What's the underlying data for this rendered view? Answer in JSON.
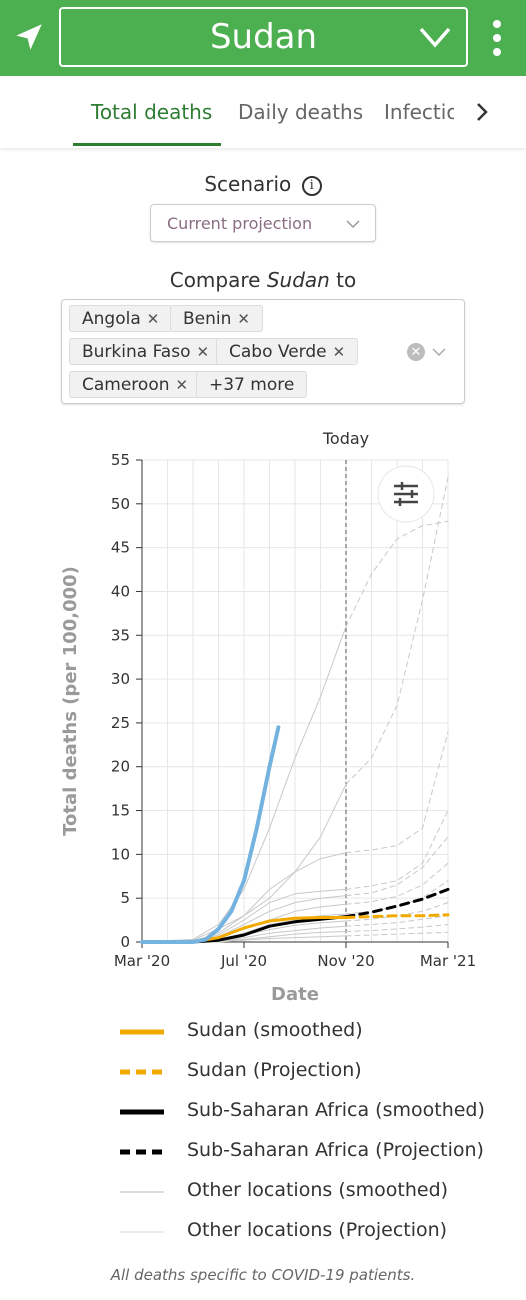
{
  "header": {
    "location": "Sudan",
    "colors": {
      "bar": "#4caf50",
      "text": "#ffffff"
    },
    "icons": {
      "nav": "navigation-arrow-icon",
      "dropdown": "chevron-down-icon",
      "menu": "more-vertical-icon"
    }
  },
  "tabs": [
    {
      "label": "Total deaths",
      "active": true
    },
    {
      "label": "Daily deaths",
      "active": false
    },
    {
      "label": "Infectio",
      "active": false
    }
  ],
  "scenario": {
    "label": "Scenario",
    "value": "Current projection"
  },
  "compare": {
    "label_prefix": "Compare ",
    "location": "Sudan",
    "label_suffix": " to",
    "chips": [
      "Angola",
      "Benin",
      "Burkina Faso",
      "Cabo Verde",
      "Cameroon"
    ],
    "more": "+37 more"
  },
  "chart_data": {
    "type": "line",
    "today_label": "Today",
    "xlabel": "Date",
    "ylabel": "Total deaths (per 100,000)",
    "ylim": [
      0,
      55
    ],
    "yticks": [
      0,
      5,
      10,
      15,
      20,
      25,
      30,
      35,
      40,
      45,
      50,
      55
    ],
    "xticks": [
      {
        "label": "Mar '20",
        "month": 0
      },
      {
        "label": "Jul '20",
        "month": 4
      },
      {
        "label": "Nov '20",
        "month": 8
      },
      {
        "label": "Mar '21",
        "month": 12
      }
    ],
    "today_month": 8.0,
    "series": [
      {
        "name": "Sudan (smoothed)",
        "color": "#f2a900",
        "style": "solid",
        "width": 3,
        "points": [
          [
            0,
            0
          ],
          [
            2,
            0
          ],
          [
            3,
            0.5
          ],
          [
            4,
            1.6
          ],
          [
            5,
            2.4
          ],
          [
            6,
            2.7
          ],
          [
            7,
            2.8
          ],
          [
            8,
            2.8
          ]
        ]
      },
      {
        "name": "Sudan (Projection)",
        "color": "#f2a900",
        "style": "dashed",
        "width": 3,
        "points": [
          [
            8,
            2.8
          ],
          [
            9,
            2.9
          ],
          [
            10,
            3.0
          ],
          [
            11,
            3.0
          ],
          [
            12,
            3.1
          ]
        ]
      },
      {
        "name": "Sub-Saharan Africa (smoothed)",
        "color": "#000000",
        "style": "solid",
        "width": 3,
        "points": [
          [
            0,
            0
          ],
          [
            2,
            0
          ],
          [
            3,
            0.2
          ],
          [
            4,
            0.8
          ],
          [
            5,
            1.8
          ],
          [
            6,
            2.3
          ],
          [
            7,
            2.6
          ],
          [
            8,
            2.9
          ]
        ]
      },
      {
        "name": "Sub-Saharan Africa (Projection)",
        "color": "#000000",
        "style": "dashed",
        "width": 3,
        "points": [
          [
            8,
            2.9
          ],
          [
            9,
            3.4
          ],
          [
            10,
            4.1
          ],
          [
            11,
            4.9
          ],
          [
            12,
            6.0
          ]
        ]
      },
      {
        "name": "Other locations (smoothed)",
        "color": "#c8c8c8",
        "style": "solid",
        "width": 1,
        "lines": [
          [
            [
              0,
              0
            ],
            [
              2,
              0.3
            ],
            [
              3,
              2
            ],
            [
              4,
              6
            ],
            [
              5,
              13
            ],
            [
              6,
              21
            ],
            [
              7,
              28
            ],
            [
              8,
              36
            ]
          ],
          [
            [
              0,
              0
            ],
            [
              2,
              0.2
            ],
            [
              3,
              1.5
            ],
            [
              4,
              3
            ],
            [
              5,
              5
            ],
            [
              6,
              8
            ],
            [
              7,
              12
            ],
            [
              8,
              18
            ]
          ],
          [
            [
              0,
              0
            ],
            [
              2,
              0.1
            ],
            [
              3,
              1
            ],
            [
              4,
              3
            ],
            [
              5,
              6
            ],
            [
              6,
              8
            ],
            [
              7,
              9.5
            ],
            [
              8,
              10.2
            ]
          ],
          [
            [
              0,
              0
            ],
            [
              2,
              0.1
            ],
            [
              3,
              0.8
            ],
            [
              4,
              2.5
            ],
            [
              5,
              4.5
            ],
            [
              6,
              5.5
            ],
            [
              7,
              5.8
            ],
            [
              8,
              6
            ]
          ],
          [
            [
              0,
              0
            ],
            [
              2,
              0.1
            ],
            [
              3,
              0.6
            ],
            [
              4,
              2
            ],
            [
              5,
              3.5
            ],
            [
              6,
              4.5
            ],
            [
              7,
              5
            ],
            [
              8,
              5.3
            ]
          ],
          [
            [
              0,
              0
            ],
            [
              2,
              0
            ],
            [
              3,
              0.5
            ],
            [
              4,
              1.5
            ],
            [
              5,
              2.5
            ],
            [
              6,
              3.5
            ],
            [
              7,
              4
            ],
            [
              8,
              4.3
            ]
          ],
          [
            [
              0,
              0
            ],
            [
              2,
              0
            ],
            [
              3,
              0.3
            ],
            [
              4,
              1
            ],
            [
              5,
              2
            ],
            [
              6,
              2.5
            ],
            [
              7,
              3
            ],
            [
              8,
              3.2
            ]
          ],
          [
            [
              0,
              0
            ],
            [
              2,
              0
            ],
            [
              3,
              0.2
            ],
            [
              4,
              0.8
            ],
            [
              5,
              1.4
            ],
            [
              6,
              1.9
            ],
            [
              7,
              2.2
            ],
            [
              8,
              2.4
            ]
          ],
          [
            [
              0,
              0
            ],
            [
              2,
              0
            ],
            [
              3,
              0.1
            ],
            [
              4,
              0.5
            ],
            [
              5,
              1
            ],
            [
              6,
              1.3
            ],
            [
              7,
              1.6
            ],
            [
              8,
              1.8
            ]
          ],
          [
            [
              0,
              0
            ],
            [
              2,
              0
            ],
            [
              3,
              0.1
            ],
            [
              4,
              0.3
            ],
            [
              5,
              0.6
            ],
            [
              6,
              0.9
            ],
            [
              7,
              1.1
            ],
            [
              8,
              1.2
            ]
          ],
          [
            [
              0,
              0
            ],
            [
              2,
              0
            ],
            [
              3,
              0
            ],
            [
              4,
              0.2
            ],
            [
              5,
              0.4
            ],
            [
              6,
              0.5
            ],
            [
              7,
              0.6
            ],
            [
              8,
              0.7
            ]
          ]
        ]
      },
      {
        "name": "Other locations (Projection)",
        "color": "#c8c8c8",
        "style": "dashed",
        "width": 1,
        "lines": [
          [
            [
              8,
              36
            ],
            [
              9,
              42
            ],
            [
              10,
              46
            ],
            [
              11,
              47.5
            ],
            [
              12,
              48
            ]
          ],
          [
            [
              8,
              18
            ],
            [
              9,
              21
            ],
            [
              10,
              27
            ],
            [
              11,
              39
            ],
            [
              12,
              53
            ]
          ],
          [
            [
              8,
              10.2
            ],
            [
              9,
              10.5
            ],
            [
              10,
              11
            ],
            [
              11,
              13
            ],
            [
              12,
              24
            ]
          ],
          [
            [
              8,
              6
            ],
            [
              9,
              6.4
            ],
            [
              10,
              7
            ],
            [
              11,
              9
            ],
            [
              12,
              15
            ]
          ],
          [
            [
              8,
              5.3
            ],
            [
              9,
              5.6
            ],
            [
              10,
              6.5
            ],
            [
              11,
              8.5
            ],
            [
              12,
              12
            ]
          ],
          [
            [
              8,
              4.3
            ],
            [
              9,
              4.6
            ],
            [
              10,
              5.2
            ],
            [
              11,
              6.5
            ],
            [
              12,
              9
            ]
          ],
          [
            [
              8,
              3.2
            ],
            [
              9,
              3.5
            ],
            [
              10,
              4
            ],
            [
              11,
              5
            ],
            [
              12,
              7
            ]
          ],
          [
            [
              8,
              2.4
            ],
            [
              9,
              2.6
            ],
            [
              10,
              3
            ],
            [
              11,
              3.5
            ],
            [
              12,
              4.5
            ]
          ],
          [
            [
              8,
              1.8
            ],
            [
              9,
              2
            ],
            [
              10,
              2.2
            ],
            [
              11,
              2.6
            ],
            [
              12,
              3
            ]
          ],
          [
            [
              8,
              1.2
            ],
            [
              9,
              1.3
            ],
            [
              10,
              1.5
            ],
            [
              11,
              1.7
            ],
            [
              12,
              2
            ]
          ],
          [
            [
              8,
              0.7
            ],
            [
              9,
              0.8
            ],
            [
              10,
              0.9
            ],
            [
              11,
              1
            ],
            [
              12,
              1.1
            ]
          ]
        ]
      },
      {
        "name": "Highlighted location",
        "color": "#74b3e0",
        "style": "solid",
        "width": 4,
        "points": [
          [
            0,
            0
          ],
          [
            2,
            0
          ],
          [
            2.5,
            0.3
          ],
          [
            3,
            1.5
          ],
          [
            3.5,
            3.5
          ],
          [
            4,
            7
          ],
          [
            4.5,
            13
          ],
          [
            5,
            20
          ],
          [
            5.35,
            24.5
          ]
        ]
      }
    ]
  },
  "legend": [
    {
      "label": "Sudan (smoothed)",
      "color": "#f2a900",
      "style": "solid"
    },
    {
      "label": "Sudan (Projection)",
      "color": "#f2a900",
      "style": "dashed"
    },
    {
      "label": "Sub-Saharan Africa (smoothed)",
      "color": "#000000",
      "style": "solid"
    },
    {
      "label": "Sub-Saharan Africa (Projection)",
      "color": "#000000",
      "style": "dashed"
    },
    {
      "label": "Other locations (smoothed)",
      "color": "#d0d0d0",
      "style": "solid"
    },
    {
      "label": "Other locations (Projection)",
      "color": "#e4e4e4",
      "style": "solid"
    }
  ],
  "footnote": "All deaths specific to COVID-19 patients."
}
